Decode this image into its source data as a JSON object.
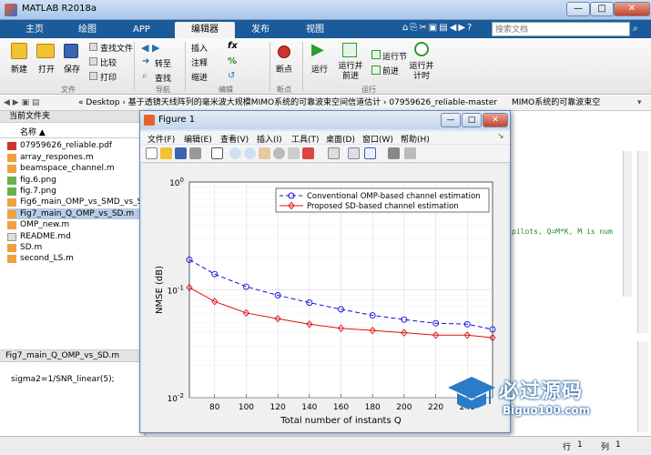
{
  "window": {
    "title": "MATLAB R2018a",
    "min": "—",
    "max": "□",
    "close": "✕"
  },
  "tabs": [
    "主页",
    "绘图",
    "APP",
    "编辑器",
    "发布",
    "视图"
  ],
  "quick_access": "⌂⎘✂▣▤◀▶?",
  "search": {
    "placeholder": "搜索文档"
  },
  "ribbon": {
    "file": [
      "新建",
      "打开",
      "保存"
    ],
    "file_small": [
      "查找文件",
      "比较",
      "打印"
    ],
    "nav": [
      "转至",
      "查找"
    ],
    "edit": [
      "插入",
      "注释",
      "缩进"
    ],
    "edit_symbols": [
      "fx",
      "%",
      "↺"
    ],
    "breakpoint": "断点",
    "run": [
      "运行",
      "运行并\n前进",
      "运行节",
      "前进",
      "运行并\n计时"
    ],
    "sections": [
      "文件",
      "导航",
      "编辑",
      "断点",
      "运行"
    ]
  },
  "address": {
    "path": "« Desktop › 基于透镜天线阵列的毫米波大规模MIMO系统的可靠波束空间信道估计 › 07959626_reliable-master",
    "right": "MIMO系统的可靠波束空"
  },
  "current_folder": {
    "header": "当前文件夹",
    "col": "名称 ▲",
    "files": [
      "07959626_reliable.pdf",
      "array_respones.m",
      "beamspace_channel.m",
      "fig.6.png",
      "fig.7.png",
      "Fig6_main_OMP_vs_SMD_vs_S",
      "Fig7_main_Q_OMP_vs_SD.m",
      "OMP_new.m",
      "README.md",
      "SD.m",
      "second_LS.m"
    ],
    "selected": 6
  },
  "details": {
    "file": "Fig7_main_Q_OMP_vs_SD.m",
    "code": "sigma2=1/SNR_linear(5);"
  },
  "editor_snippet": "pilots, Q=M*K, M is num",
  "status": {
    "line_label": "行",
    "line": "1",
    "col_label": "列",
    "col": "1"
  },
  "figure": {
    "title": "Figure 1",
    "menu": [
      "文件(F)",
      "编辑(E)",
      "查看(V)",
      "插入(I)",
      "工具(T)",
      "桌面(D)",
      "窗口(W)",
      "帮助(H)"
    ]
  },
  "watermark": {
    "text": "必过源码",
    "url": "Biguo100.com"
  },
  "colors": {
    "series1": "#1010e0",
    "series2": "#e01010",
    "accent": "#1b5b9a"
  },
  "chart_data": {
    "type": "line",
    "title": "",
    "xlabel": "Total number of instants Q",
    "ylabel": "NMSE (dB)",
    "xlim": [
      64,
      256
    ],
    "ylim": [
      0.01,
      1
    ],
    "yscale": "log",
    "xticks": [
      "80",
      "100",
      "120",
      "140",
      "160",
      "180",
      "200",
      "220",
      "240"
    ],
    "yticks": [
      "10^0",
      "10^-1",
      "10^-2"
    ],
    "grid": true,
    "legend_position": "top-right",
    "x": [
      64,
      80,
      100,
      120,
      140,
      160,
      180,
      200,
      220,
      240,
      256
    ],
    "series": [
      {
        "name": "Conventional OMP-based channel estimation",
        "style": "dashed",
        "marker": "circle",
        "color": "#1010e0",
        "values": [
          0.19,
          0.14,
          0.107,
          0.089,
          0.076,
          0.066,
          0.058,
          0.053,
          0.049,
          0.048,
          0.043
        ]
      },
      {
        "name": "Proposed SD-based channel estimation",
        "style": "solid",
        "marker": "diamond",
        "color": "#e01010",
        "values": [
          0.105,
          0.078,
          0.061,
          0.054,
          0.048,
          0.044,
          0.042,
          0.04,
          0.038,
          0.038,
          0.036
        ]
      }
    ]
  }
}
